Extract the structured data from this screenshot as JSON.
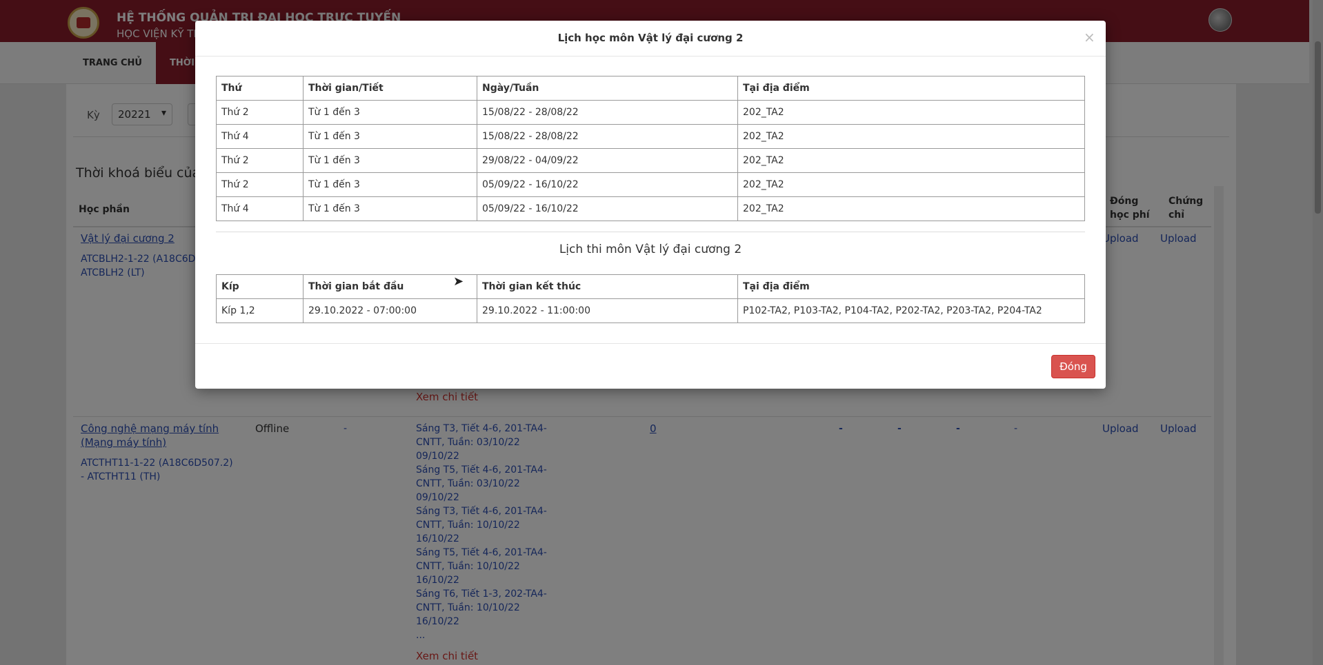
{
  "header": {
    "system_title": "HỆ THỐNG QUẢN TRỊ ĐẠI HỌC TRỰC TUYẾN",
    "system_subtitle": "HỌC VIỆN KỸ TH"
  },
  "nav": {
    "items": [
      {
        "label": "TRANG CHỦ"
      },
      {
        "label": "THỜI"
      }
    ]
  },
  "filter": {
    "term_label": "Kỳ",
    "term_value": "20221"
  },
  "page": {
    "section_title": "Thời khoá biểu của",
    "columns": {
      "course": "Học phần",
      "fee": "Đóng học phí",
      "cert": "Chứng chỉ"
    },
    "rows": [
      {
        "course_link": "Vật lý đại cương 2",
        "class_code": "ATCBLH2-1-22 (A18C6D5",
        "class_code2": "ATCBLH2 (LT)",
        "detail_link": "Xem chi tiết",
        "upload1": "Upload",
        "upload2": "Upload"
      },
      {
        "course_link": "Công nghệ mạng máy tính (Mạng máy tính)",
        "mode": "Offline",
        "dash": "-",
        "class_code": "ATCTHT11-1-22 (A18C6D507.2) - ATCTHT11 (TH)",
        "schedule": [
          "Sáng T3, Tiết 4-6, 201-TA4-CNTT, Tuần: 03/10/22 09/10/22",
          "Sáng T5, Tiết 4-6, 201-TA4-CNTT, Tuần: 03/10/22 09/10/22",
          "Sáng T3, Tiết 4-6, 201-TA4-CNTT, Tuần: 10/10/22 16/10/22",
          "Sáng T5, Tiết 4-6, 201-TA4-CNTT, Tuần: 10/10/22 16/10/22",
          "Sáng T6, Tiết 1-3, 202-TA4-CNTT, Tuần: 10/10/22 16/10/22",
          "..."
        ],
        "count_link": "0",
        "dashes": [
          "-",
          "-",
          "-",
          "-"
        ],
        "detail_link": "Xem chi tiết",
        "upload1": "Upload",
        "upload2": "Upload"
      }
    ]
  },
  "modal": {
    "title": "Lịch học môn Vật lý đại cương 2",
    "close_symbol": "×",
    "schedule_headers": [
      "Thứ",
      "Thời gian/Tiết",
      "Ngày/Tuần",
      "Tại địa điểm"
    ],
    "schedule_rows": [
      [
        "Thứ 2",
        "Từ 1 đến 3",
        "15/08/22 - 28/08/22",
        "202_TA2"
      ],
      [
        "Thứ 4",
        "Từ 1 đến 3",
        "15/08/22 - 28/08/22",
        "202_TA2"
      ],
      [
        "Thứ 2",
        "Từ 1 đến 3",
        "29/08/22 - 04/09/22",
        "202_TA2"
      ],
      [
        "Thứ 2",
        "Từ 1 đến 3",
        "05/09/22 - 16/10/22",
        "202_TA2"
      ],
      [
        "Thứ 4",
        "Từ 1 đến 3",
        "05/09/22 - 16/10/22",
        "202_TA2"
      ]
    ],
    "exam_title": "Lịch thi môn Vật lý đại cương 2",
    "exam_headers": [
      "Kíp",
      "Thời gian bắt đầu",
      "Thời gian kết thúc",
      "Tại địa điểm"
    ],
    "exam_rows": [
      [
        "Kíp 1,2",
        "29.10.2022 - 07:00:00",
        "29.10.2022 - 11:00:00",
        "P102-TA2, P103-TA2, P104-TA2, P202-TA2, P203-TA2, P204-TA2"
      ]
    ],
    "close_button": "Đóng"
  }
}
